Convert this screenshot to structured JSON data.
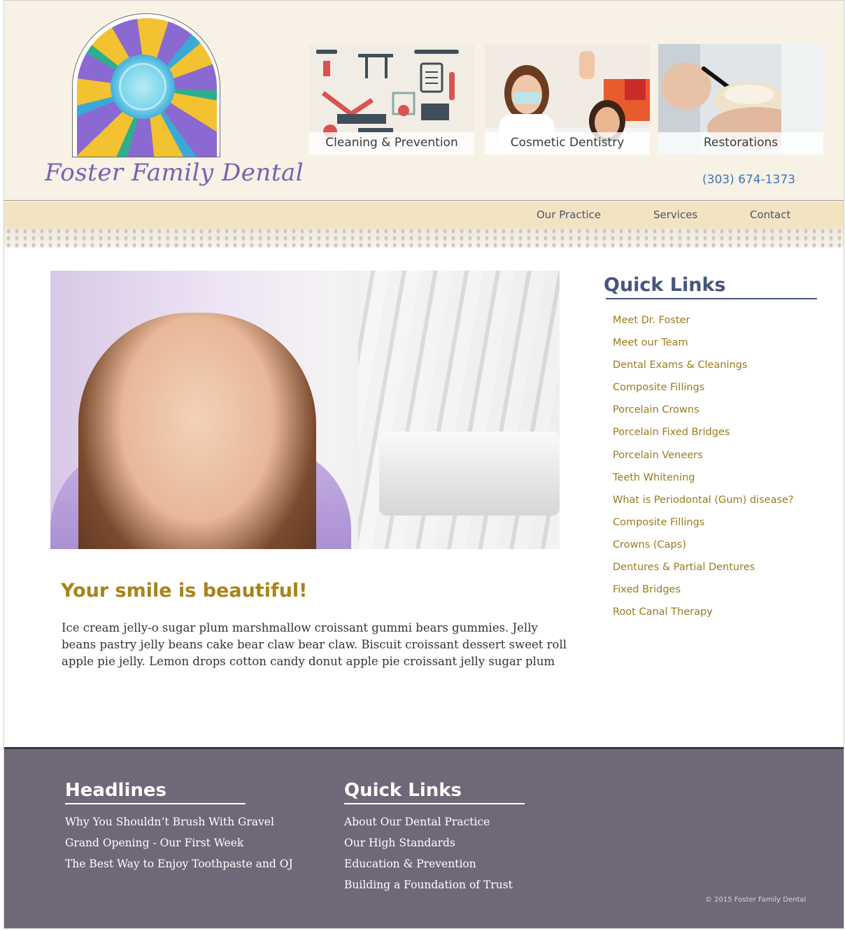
{
  "header": {
    "logo_text": "Foster Family Dental",
    "phone": "(303) 674-1373",
    "service_cards": [
      {
        "label": "Cleaning & Prevention"
      },
      {
        "label": "Cosmetic Dentistry"
      },
      {
        "label": "Restorations"
      }
    ]
  },
  "nav": {
    "items": [
      "Our Practice",
      "Services",
      "Contact"
    ]
  },
  "main": {
    "headline": "Your smile is beautiful!",
    "body": "Ice cream jelly-o sugar plum marshmallow croissant gummi bears gummies. Jelly beans pastry jelly beans cake bear claw bear claw. Biscuit croissant dessert sweet roll apple pie jelly. Lemon drops cotton candy donut apple pie croissant jelly sugar plum"
  },
  "sidebar": {
    "title": "Quick Links",
    "links": [
      "Meet Dr. Foster",
      "Meet our Team",
      "Dental Exams & Cleanings",
      "Composite Fillings",
      "Porcelain Crowns",
      "Porcelain Fixed Bridges",
      "Porcelain Veneers",
      "Teeth Whitening",
      "What is Periodontal (Gum) disease?",
      "Composite Fillings",
      "Crowns (Caps)",
      "Dentures & Partial Dentures",
      "Fixed Bridges",
      "Root Canal Therapy"
    ]
  },
  "footer": {
    "headlines_title": "Headlines",
    "headlines": [
      "Why You Shouldn’t Brush With Gravel",
      "Grand Opening - Our First Week",
      "The Best Way to Enjoy Toothpaste and OJ"
    ],
    "quicklinks_title": "Quick Links",
    "quicklinks": [
      "About Our Dental Practice",
      "Our High Standards",
      "Education & Prevention",
      "Building a Foundation of Trust"
    ],
    "copyright": "© 2015 Foster Family Dental"
  },
  "colors": {
    "header_bg": "#f8f1e5",
    "nav_bg": "#f2e3c3",
    "link_gold": "#9a7a1e",
    "headline_gold": "#a8831a",
    "quicklinks_blue": "#46567a",
    "phone_blue": "#3a78b8",
    "footer_bg": "#6f6878"
  }
}
